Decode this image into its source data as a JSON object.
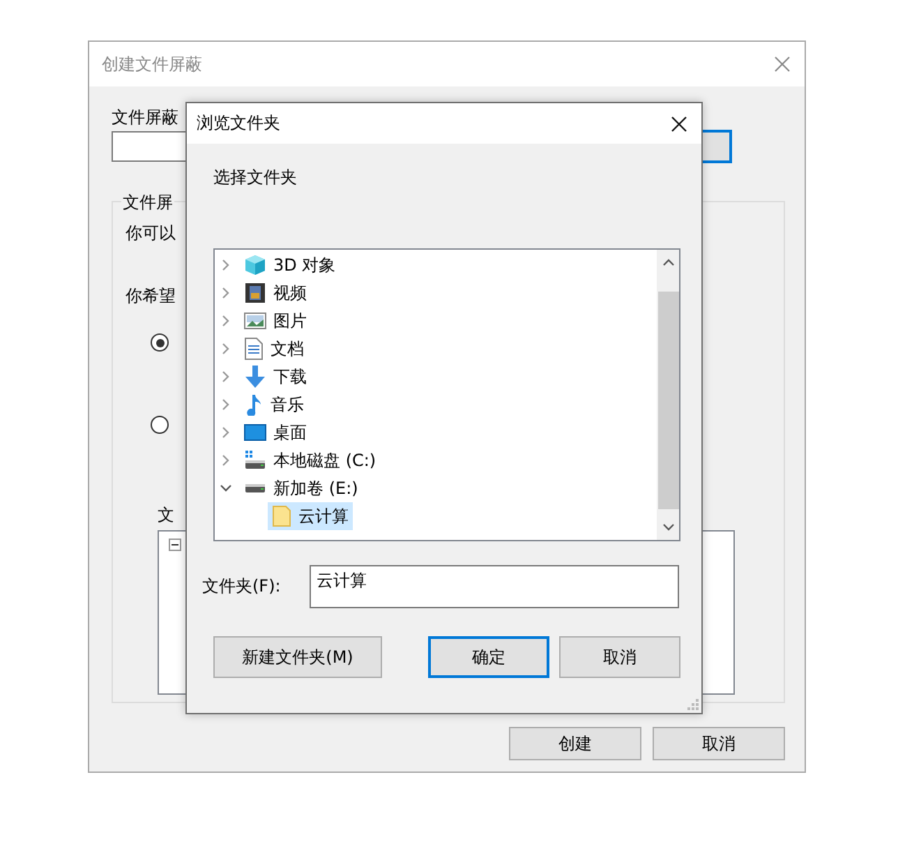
{
  "back_window": {
    "title": "创建文件屏蔽",
    "path_label": "文件屏蔽",
    "group_title": "文件屏",
    "line_1": "你可以",
    "line_2": "你希望",
    "radios": [
      {
        "selected": true
      },
      {
        "selected": false
      }
    ],
    "tree_label": "文",
    "buttons": [
      "创建",
      "取消"
    ]
  },
  "browse_dialog": {
    "title": "浏览文件夹",
    "prompt": "选择文件夹",
    "tree": [
      {
        "label": "3D 对象",
        "kind": "cube",
        "expanded": false
      },
      {
        "label": "视频",
        "kind": "film",
        "expanded": false
      },
      {
        "label": "图片",
        "kind": "image",
        "expanded": false
      },
      {
        "label": "文档",
        "kind": "document",
        "expanded": false
      },
      {
        "label": "下载",
        "kind": "download",
        "expanded": false
      },
      {
        "label": "音乐",
        "kind": "music",
        "expanded": false
      },
      {
        "label": "桌面",
        "kind": "desktop",
        "expanded": false
      },
      {
        "label": "本地磁盘 (C:)",
        "kind": "systemdrive",
        "expanded": false
      },
      {
        "label": "新加卷 (E:)",
        "kind": "drive",
        "expanded": true,
        "children": [
          {
            "label": "云计算",
            "kind": "folder",
            "selected": true
          }
        ]
      }
    ],
    "folder_label": "文件夹(F):",
    "folder_value": "云计算",
    "buttons": [
      {
        "label": "新建文件夹(M)",
        "default": false
      },
      {
        "label": "确定",
        "default": true
      },
      {
        "label": "取消",
        "default": false
      }
    ]
  }
}
